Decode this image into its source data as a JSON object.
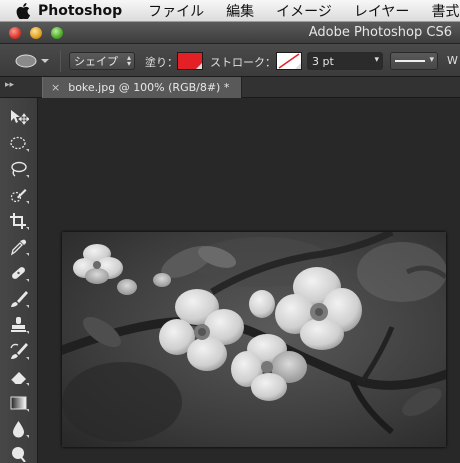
{
  "menubar": {
    "app_name": "Photoshop",
    "items": [
      "ファイル",
      "編集",
      "イメージ",
      "レイヤー",
      "書式"
    ]
  },
  "window": {
    "title": "Adobe Photoshop CS6"
  },
  "options": {
    "mode_label": "シェイプ",
    "fill_label": "塗り：",
    "fill_color": "#e32026",
    "stroke_label": "ストローク：",
    "stroke_width": "3 pt",
    "trailing_label": "W"
  },
  "document_tab": {
    "title": "boke.jpg @ 100% (RGB/8#) *",
    "close_symbol": "×"
  },
  "toolbar_collapse": "▸▸",
  "toolbox": {
    "tools": [
      "move-tool",
      "ellipse-marquee-tool",
      "lasso-tool",
      "quick-selection-tool",
      "crop-tool",
      "eyedropper-tool",
      "spot-healing-tool",
      "brush-tool",
      "clone-stamp-tool",
      "history-brush-tool",
      "eraser-tool",
      "gradient-tool",
      "blur-tool",
      "dodge-tool"
    ]
  },
  "canvas": {
    "image_description_color": "#3a3a3a"
  }
}
